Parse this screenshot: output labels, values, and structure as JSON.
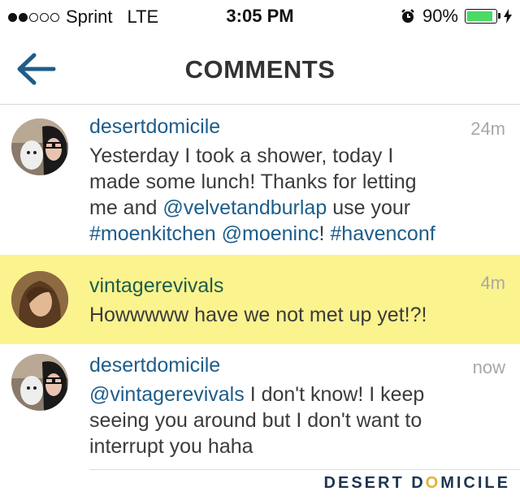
{
  "status_bar": {
    "carrier": "Sprint",
    "network": "LTE",
    "time": "3:05 PM",
    "battery": "90%",
    "battery_level": 0.9
  },
  "nav": {
    "title": "COMMENTS",
    "back_icon": "back-arrow-icon"
  },
  "colors": {
    "link": "#1d5d8a",
    "highlight": "#fbf38e",
    "battery": "#4cd964"
  },
  "comments": [
    {
      "username": "desertdomicile",
      "time": "24m",
      "text_lines": {
        "l1": "Yesterday I took a shower, today I",
        "l2": "made some lunch! Thanks for letting",
        "l3_pre": "me and ",
        "l3_mention": "@velvetandburlap",
        "l3_post": " use your",
        "l4_tag1": "#moenkitchen",
        "l4_sp1": " ",
        "l4_mention": "@moeninc",
        "l4_sep": "! ",
        "l4_tag2": "#havenconf"
      }
    },
    {
      "username": "vintagerevivals",
      "time": "4m",
      "text": "Howwwww have we not met up yet!?!"
    },
    {
      "username": "desertdomicile",
      "time": "now",
      "text_lines": {
        "l1_mention": "@vintagerevivals",
        "l1_post": " I don't know! I keep",
        "l2": "seeing you around but I don't want to",
        "l3": "interrupt you haha"
      }
    }
  ],
  "footer": {
    "logo_part1": "DESERT D",
    "logo_o": "O",
    "logo_part2": "MICILE"
  }
}
